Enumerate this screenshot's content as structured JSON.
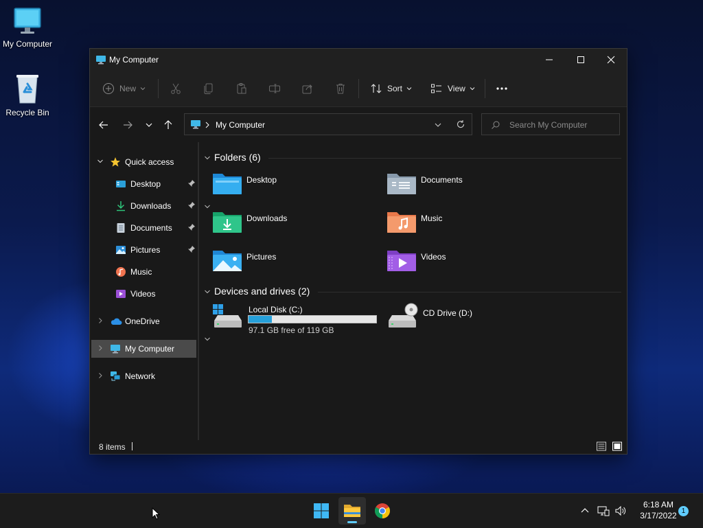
{
  "desktop": {
    "icons": [
      {
        "label": "My Computer",
        "icon": "monitor-icon"
      },
      {
        "label": "Recycle Bin",
        "icon": "recycle-bin-icon"
      }
    ]
  },
  "window": {
    "title": "My Computer",
    "toolbar": {
      "new_label": "New",
      "sort_label": "Sort",
      "view_label": "View"
    },
    "address": {
      "path_label": "My Computer"
    },
    "search": {
      "placeholder": "Search My Computer"
    },
    "sidebar": {
      "quick_access": "Quick access",
      "items": [
        {
          "label": "Desktop",
          "pinned": true
        },
        {
          "label": "Downloads",
          "pinned": true
        },
        {
          "label": "Documents",
          "pinned": true
        },
        {
          "label": "Pictures",
          "pinned": true
        },
        {
          "label": "Music",
          "pinned": false
        },
        {
          "label": "Videos",
          "pinned": false
        }
      ],
      "onedrive": "OneDrive",
      "my_computer": "My Computer",
      "network": "Network"
    },
    "folders_header": "Folders (6)",
    "folders": [
      {
        "name": "Desktop",
        "icon": "desktop-folder-icon"
      },
      {
        "name": "Documents",
        "icon": "documents-folder-icon"
      },
      {
        "name": "Downloads",
        "icon": "downloads-folder-icon"
      },
      {
        "name": "Music",
        "icon": "music-folder-icon"
      },
      {
        "name": "Pictures",
        "icon": "pictures-folder-icon"
      },
      {
        "name": "Videos",
        "icon": "videos-folder-icon"
      }
    ],
    "drives_header": "Devices and drives (2)",
    "drives": [
      {
        "name": "Local Disk (C:)",
        "free_text": "97.1 GB free of 119 GB",
        "used_fraction": 0.184
      },
      {
        "name": "CD Drive (D:)"
      }
    ],
    "status": {
      "items_text": "8 items"
    }
  },
  "taskbar": {
    "time": "6:18 AM",
    "date": "3/17/2022",
    "notification_count": "1"
  },
  "colors": {
    "accent": "#60cdff",
    "drive_bar": "#26a0da",
    "selection": "#4a4a4a"
  }
}
